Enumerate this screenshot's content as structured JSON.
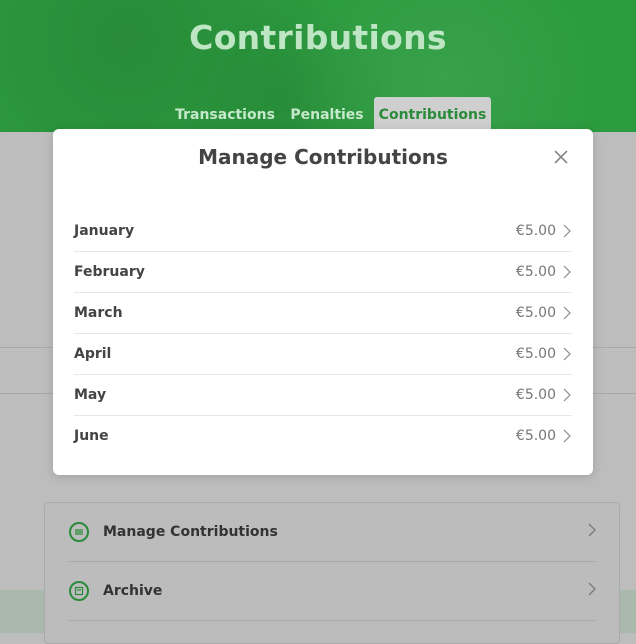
{
  "header": {
    "title": "Contributions"
  },
  "tabs": [
    {
      "label": "Transactions",
      "active": false
    },
    {
      "label": "Penalties",
      "active": false
    },
    {
      "label": "Contributions",
      "active": true
    }
  ],
  "menu": [
    {
      "label": "Manage Contributions",
      "icon": "contributions-icon"
    },
    {
      "label": "Archive",
      "icon": "archive-icon"
    }
  ],
  "modal": {
    "title": "Manage Contributions",
    "close_icon": "close-icon",
    "months": [
      {
        "label": "January",
        "amount": "€5.00"
      },
      {
        "label": "February",
        "amount": "€5.00"
      },
      {
        "label": "March",
        "amount": "€5.00"
      },
      {
        "label": "April",
        "amount": "€5.00"
      },
      {
        "label": "May",
        "amount": "€5.00"
      },
      {
        "label": "June",
        "amount": "€5.00"
      }
    ]
  },
  "colors": {
    "brand_green": "#2c9b3f",
    "accent_green": "#2a8b3a"
  }
}
